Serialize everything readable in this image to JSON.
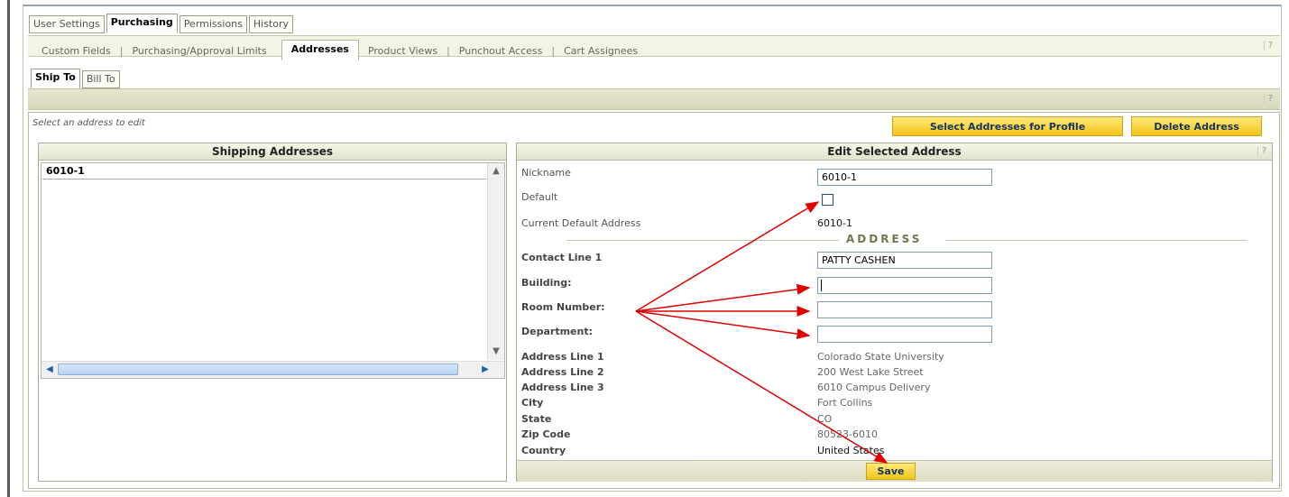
{
  "main_tabs": [
    "User Settings",
    "Purchasing",
    "Permissions",
    "History"
  ],
  "active_main_tab": "Purchasing",
  "sub_nav": {
    "items": [
      "Custom Fields",
      "Purchasing/Approval Limits",
      "Addresses",
      "Product Views",
      "Punchout Access",
      "Cart Assignees"
    ],
    "separator": "|",
    "selected": "Addresses",
    "help": "?"
  },
  "address_tabs": [
    "Ship To",
    "Bill To"
  ],
  "strip_help": "?",
  "hint": "Select an address to edit",
  "buttons": {
    "select_addresses": "Select Addresses for Profile",
    "delete_address": "Delete Address",
    "save": "Save"
  },
  "shipping_addresses": {
    "title": "Shipping Addresses",
    "items": [
      "6010-1"
    ]
  },
  "edit_panel": {
    "title": "Edit Selected Address",
    "help": "?",
    "nickname_label": "Nickname",
    "nickname_value": "6010-1",
    "default_label": "Default",
    "current_default_label": "Current Default Address",
    "current_default_value": "6010-1",
    "section_title": "ADDRESS",
    "contact_label": "Contact Line 1",
    "contact_value": "PATTY CASHEN",
    "building_label": "Building:",
    "building_value": "",
    "room_label": "Room Number:",
    "room_value": "",
    "department_label": "Department:",
    "department_value": "",
    "address1_label": "Address Line 1",
    "address1_value": "Colorado State University",
    "address2_label": "Address Line 2",
    "address2_value": "200 West Lake Street",
    "address3_label": "Address Line 3",
    "address3_value": "6010 Campus Delivery",
    "city_label": "City",
    "city_value": "Fort Collins",
    "state_label": "State",
    "state_value": "CO",
    "zip_label": "Zip Code",
    "zip_value": "80523-6010",
    "country_label": "Country",
    "country_value": "United States"
  },
  "scroll_icons": {
    "left": "◀",
    "right": "▶",
    "up": "▲",
    "down": "▼"
  },
  "colors": {
    "annotation_arrow": "#e00000",
    "button_yellow": "#f3c418",
    "button_text": "#16365f"
  }
}
